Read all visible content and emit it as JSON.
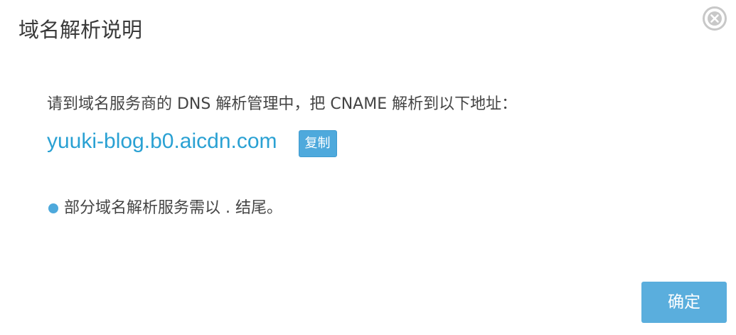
{
  "dialog": {
    "title": "域名解析说明",
    "close_icon": "close-circle-icon"
  },
  "content": {
    "instruction": "请到域名服务商的 DNS 解析管理中，把 CNAME 解析到以下地址：",
    "cname_value": "yuuki-blog.b0.aicdn.com",
    "copy_label": "复制",
    "note_text": "部分域名解析服务需以 . 结尾。"
  },
  "footer": {
    "confirm_label": "确定"
  },
  "colors": {
    "accent": "#4ea9dc",
    "link": "#2aa1d3",
    "close_icon": "#c8c8c8"
  }
}
